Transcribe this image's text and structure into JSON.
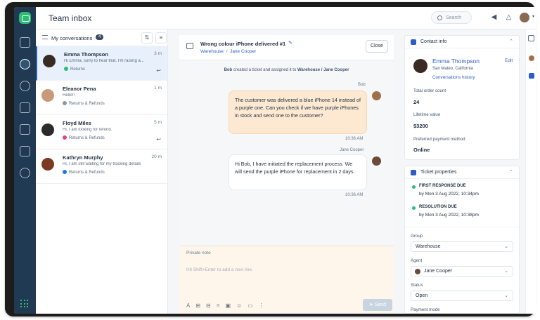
{
  "app": {
    "title": "Team inbox",
    "search_placeholder": "Search",
    "brand_color": "#2dbc73",
    "accent": "#2c5cc5"
  },
  "list": {
    "header": "My conversations",
    "count": "4",
    "items": [
      {
        "name": "Emma Thompson",
        "time": "3 m",
        "preview": "Hi Emma, sorry to hear that. I'm raising a...",
        "tag": "Returns",
        "tag_color": "#2dbc73"
      },
      {
        "name": "Eleanor Pena",
        "time": "1 m",
        "preview": "Hello!!",
        "tag": "Returns & Refunds",
        "tag_color": "#8a97a5"
      },
      {
        "name": "Floyd Miles",
        "time": "5 m",
        "preview": "Hi, I am looking for refund.",
        "tag": "Returns & Refunds",
        "tag_color": "#e0457b"
      },
      {
        "name": "Kathryn Murphy",
        "time": "20 m",
        "preview": "Hi, I am still waiting for my tracking details",
        "tag": "Returns & Refunds",
        "tag_color": "#1877f2"
      }
    ]
  },
  "ticket": {
    "title": "Wrong colour iPhone delivered #1",
    "group": "Warehouse",
    "agent": "Jane Cooper",
    "sep": "/",
    "close_label": "Close",
    "sys_pre": "Bob",
    "sys_mid": " created a ticket and assigned it to ",
    "sys_post": "Warehouse / Jane Cooper",
    "msg1_author": "Bob",
    "msg1_text": "The customer was delivered a blue iPhone 14 instead of a purple one. Can you check if we have purple iPhones in stock and send one to the customer?",
    "msg1_time": "10:36 AM",
    "msg2_author": "Jane Cooper",
    "msg2_text": "Hi Bob, I have initiated the replacement process. We will send the purple iPhone for replacement in 2 days.",
    "msg2_time": "10:36 AM",
    "note_label": "Private note",
    "note_placeholder": "Hit Shift+Enter to add a new line.",
    "send_label": "Send"
  },
  "contact": {
    "header": "Contact info",
    "name": "Emma Thompson",
    "location": "San Mateo, California",
    "edit": "Edit",
    "history": "Conversations history",
    "order_count_label": "Total order count",
    "order_count": "24",
    "ltv_label": "Lifetime value",
    "ltv": "$3200",
    "pay_label": "Preferred payment method",
    "pay": "Online"
  },
  "props": {
    "header": "Ticket properties",
    "frd_label": "FIRST RESPONSE DUE",
    "frd": "by Mon 3 Aug 2022, 10:34pm",
    "rd_label": "RESOLUTION DUE",
    "rd": "by Mon 3 Aug 2022, 10:38pm",
    "group_label": "Group",
    "group": "Warehouse",
    "agent_label": "Agent",
    "agent": "Jane Cooper",
    "status_label": "Status",
    "status": "Open",
    "payment_label": "Payment mode"
  }
}
